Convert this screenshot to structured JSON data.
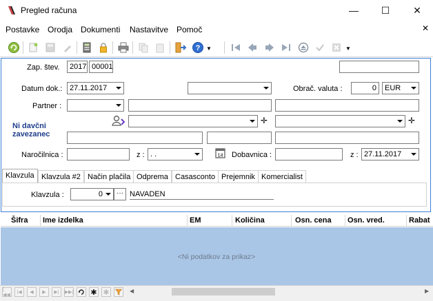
{
  "window": {
    "title": "Pregled računa",
    "controls": {
      "minimize": "—",
      "maximize": "☐",
      "close": "✕"
    }
  },
  "menu": {
    "items": [
      "Postavke",
      "Orodja",
      "Dokumenti",
      "Nastavitve",
      "Pomoč"
    ],
    "close": "✕"
  },
  "form": {
    "zap_label": "Zap. štev.",
    "zap_year": "2017",
    "zap_num": "00001",
    "datum_label": "Datum dok.:",
    "datum_value": "27.11.2017",
    "valuta_label": "Obrač. valuta :",
    "valuta_value": "0",
    "valuta_currency": "EUR",
    "partner_label": "Partner :",
    "ni_davcni": "Ni davčni",
    "zavezanec": "zavezanec",
    "narocilnica_label": "Naročilnica :",
    "z_label_1": "z :",
    "z_value_1": ". .",
    "dobavnica_label": "Dobavnica :",
    "z_label_2": "z :",
    "z_value_2": "27.11.2017",
    "calendar_day": "14"
  },
  "tabs": [
    "Klavzula",
    "Klavzula #2",
    "Način plačila",
    "Odprema",
    "Casasconto",
    "Prejemnik",
    "Komercialist"
  ],
  "klavzula": {
    "label": "Klavzula :",
    "value": "0",
    "more": "···",
    "text": "NAVADEN"
  },
  "grid": {
    "columns": [
      "Šifra",
      "Ime izdelka",
      "EM",
      "Količina",
      "Osn. cena",
      "Osn. vred.",
      "Rabat"
    ],
    "empty": "<Ni podatkov za prikaz>"
  },
  "nav": {
    "buttons": [
      "|◀◀",
      "|◀",
      "◀",
      "▶",
      "▶|",
      "▶▶|"
    ]
  },
  "colors": {
    "accent": "#3d7fd6",
    "grid_bg": "#aac6e7",
    "ni_davcni": "#1f3d8a"
  }
}
